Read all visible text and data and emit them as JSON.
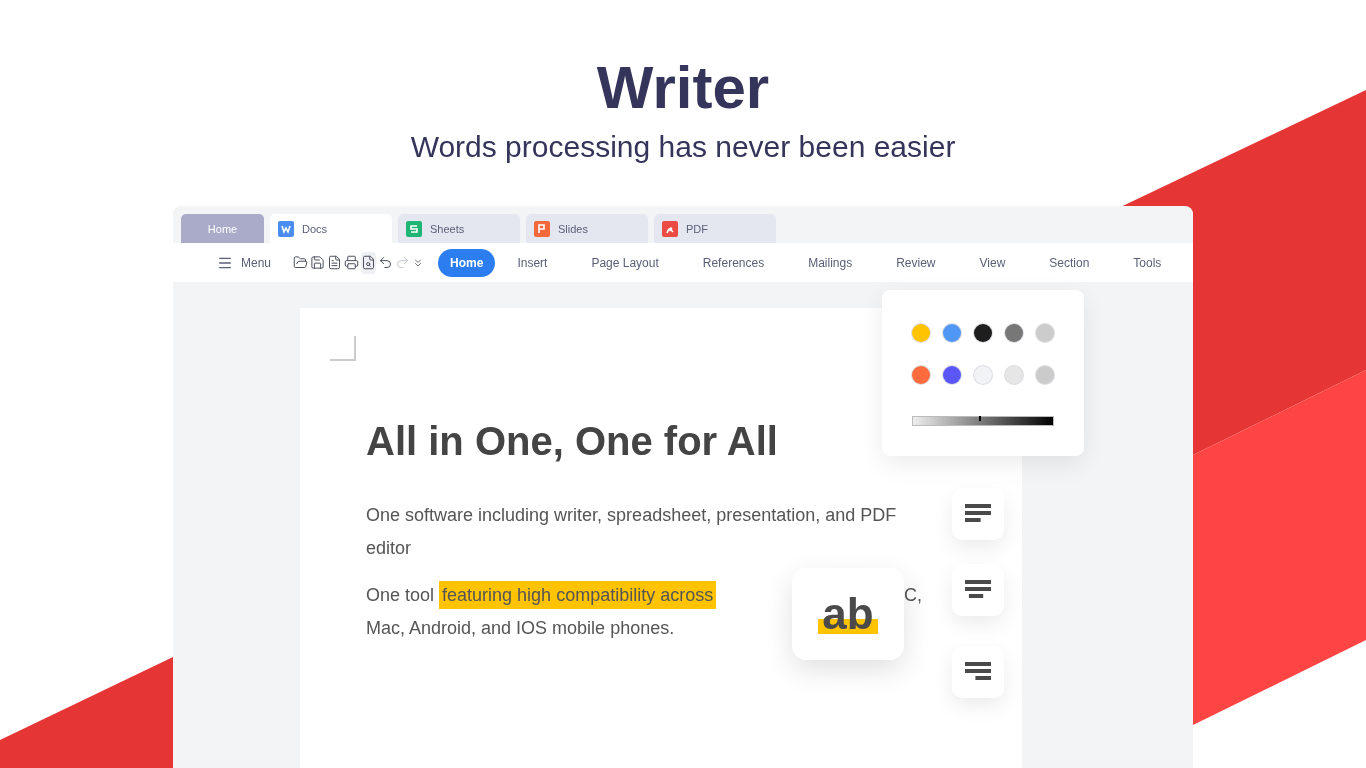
{
  "hero": {
    "title": "Writer",
    "subtitle": "Words processing has never been easier"
  },
  "tabs": [
    {
      "label": "Home",
      "kind": "home",
      "selected": false
    },
    {
      "label": "Docs",
      "kind": "docs",
      "selected": true,
      "color": "#4a8cf0"
    },
    {
      "label": "Sheets",
      "kind": "sheets",
      "selected": false,
      "color": "#1fb574"
    },
    {
      "label": "Slides",
      "kind": "slides",
      "selected": false,
      "color": "#f5683c"
    },
    {
      "label": "PDF",
      "kind": "pdf",
      "selected": false,
      "color": "#ec4b44"
    }
  ],
  "toolbar": {
    "menu": "Menu",
    "icons": [
      {
        "kind": "open",
        "selected": false,
        "disabled": false
      },
      {
        "kind": "save",
        "selected": false,
        "disabled": false
      },
      {
        "kind": "pdf",
        "selected": false,
        "disabled": false
      },
      {
        "kind": "print",
        "selected": false,
        "disabled": false
      },
      {
        "kind": "preview",
        "selected": true,
        "disabled": false
      },
      {
        "kind": "undo",
        "selected": false,
        "disabled": false
      },
      {
        "kind": "redo",
        "selected": false,
        "disabled": true
      },
      {
        "kind": "more",
        "selected": false,
        "disabled": false
      }
    ],
    "ribbon_tabs": [
      {
        "label": "Home",
        "selected": true
      },
      {
        "label": "Insert",
        "selected": false
      },
      {
        "label": "Page Layout",
        "selected": false
      },
      {
        "label": "References",
        "selected": false
      },
      {
        "label": "Mailings",
        "selected": false
      },
      {
        "label": "Review",
        "selected": false
      },
      {
        "label": "View",
        "selected": false
      },
      {
        "label": "Section",
        "selected": false
      },
      {
        "label": "Tools",
        "selected": false
      }
    ]
  },
  "document": {
    "heading": "All in One, One for All",
    "paragraph_1": "One software including writer, spreadsheet, presentation, and PDF editor",
    "paragraph_2": {
      "before": "One tool ",
      "highlight": "featuring high compatibility across",
      "after_cover": "C,",
      "line_2": "Mac, Android, and IOS mobile phones."
    }
  },
  "color_panel": {
    "swatches": [
      {
        "color": "#ffc300"
      },
      {
        "color": "#4f96f5"
      },
      {
        "color": "#1e1e1e"
      },
      {
        "color": "#777777"
      },
      {
        "color": "#cccccc"
      },
      {
        "color": "#ff6b3d"
      },
      {
        "color": "#5b57f7"
      },
      {
        "color": "#f2f3f5"
      },
      {
        "color": "#e6e6e6"
      },
      {
        "color": "#cbcbcb"
      }
    ],
    "shade": {
      "level": 0.48
    }
  },
  "highlight_card": {
    "text": "ab"
  },
  "align_buttons": [
    {
      "kind": "left"
    },
    {
      "kind": "center"
    },
    {
      "kind": "right"
    }
  ]
}
